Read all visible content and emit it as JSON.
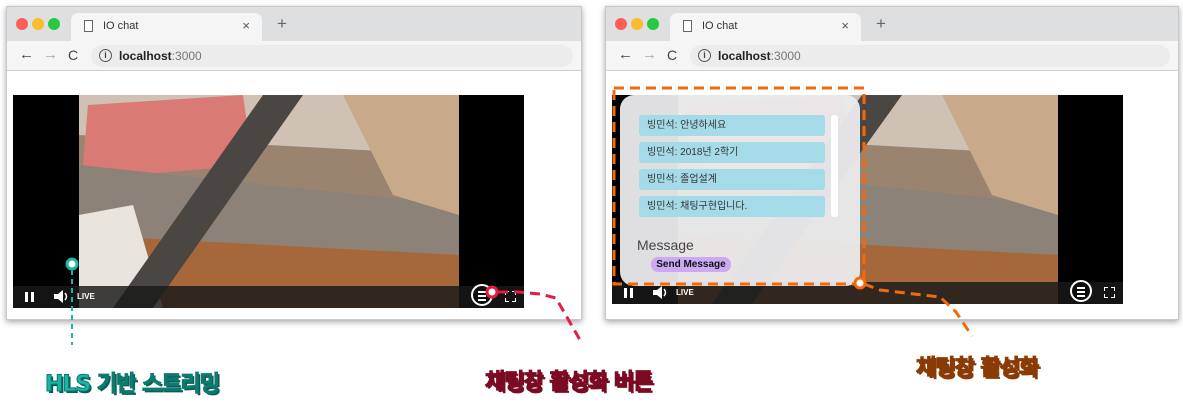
{
  "left_window": {
    "tab_title": "IO chat",
    "tab_close": "×",
    "new_tab": "+",
    "url_host": "localhost",
    "url_port": ":3000",
    "controls": {
      "live_label": "LIVE"
    }
  },
  "right_window": {
    "tab_title": "IO chat",
    "tab_close": "×",
    "new_tab": "+",
    "url_host": "localhost",
    "url_port": ":3000",
    "controls": {
      "live_label": "LIVE"
    },
    "chat": {
      "messages": [
        "빙민석: 안녕하세요",
        "빙민석: 2018년 2학기",
        "빙민석: 졸업설계",
        "빙민석: 채팅구현입니다."
      ],
      "message_label": "Message",
      "send_button": "Send Message"
    }
  },
  "annotations": {
    "hls_streaming": "HLS 기반 스트리밍",
    "chat_toggle_button": "채팅창 활성화 버튼",
    "chat_activated": "채팅창 활성화",
    "colors": {
      "teal": "#1ab6a4",
      "red": "#e41c44",
      "orange": "#f06b10"
    }
  },
  "icons": [
    "page-icon",
    "info-icon",
    "back-arrow-icon",
    "forward-arrow-icon",
    "reload-icon",
    "pause-icon",
    "volume-icon",
    "chat-toggle-icon",
    "fullscreen-icon"
  ]
}
